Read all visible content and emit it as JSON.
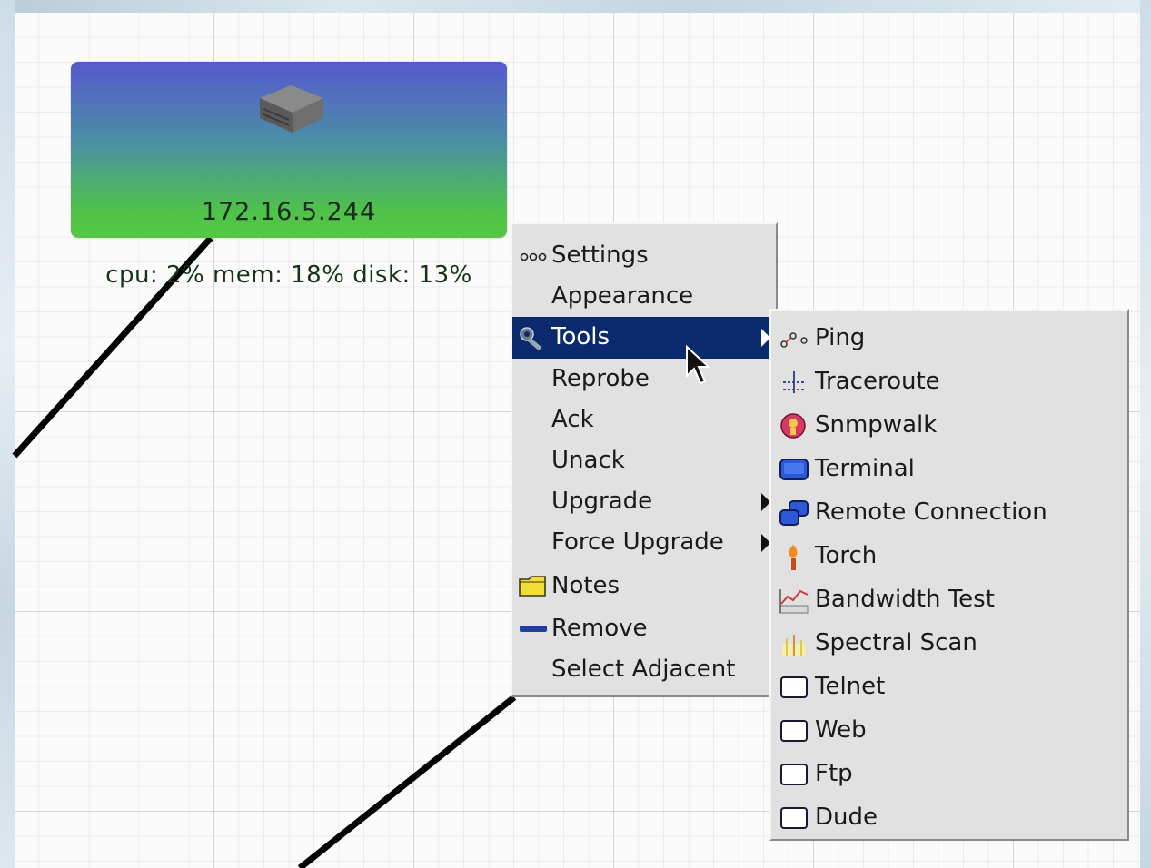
{
  "device": {
    "ip": "172.16.5.244",
    "stats": "cpu: 2% mem: 18% disk: 13%",
    "icon": "server-icon"
  },
  "context_menu": {
    "items": [
      {
        "label": "Settings",
        "icon": "settings-icon"
      },
      {
        "label": "Appearance"
      },
      {
        "label": "Tools",
        "icon": "tools-icon",
        "submenu": true,
        "highlighted": true
      },
      {
        "label": "Reprobe"
      },
      {
        "label": "Ack"
      },
      {
        "label": "Unack"
      },
      {
        "label": "Upgrade",
        "submenu": true
      },
      {
        "label": "Force Upgrade",
        "submenu": true
      },
      {
        "label": "Notes",
        "icon": "notes-folder-icon"
      },
      {
        "label": "Remove",
        "icon": "remove-icon"
      },
      {
        "label": "Select Adjacent"
      }
    ]
  },
  "tools_submenu": {
    "items": [
      {
        "label": "Ping",
        "icon": "ping-icon"
      },
      {
        "label": "Traceroute",
        "icon": "traceroute-icon"
      },
      {
        "label": "Snmpwalk",
        "icon": "snmpwalk-icon"
      },
      {
        "label": "Terminal",
        "icon": "terminal-icon"
      },
      {
        "label": "Remote Connection",
        "icon": "remote-connection-icon"
      },
      {
        "label": "Torch",
        "icon": "torch-icon"
      },
      {
        "label": "Bandwidth Test",
        "icon": "bandwidth-test-icon"
      },
      {
        "label": "Spectral Scan",
        "icon": "spectral-scan-icon"
      },
      {
        "label": "Telnet",
        "icon": "window-icon"
      },
      {
        "label": "Web",
        "icon": "window-icon"
      },
      {
        "label": "Ftp",
        "icon": "window-icon"
      },
      {
        "label": "Dude",
        "icon": "window-icon"
      }
    ]
  },
  "colors": {
    "highlight": "#0b2a6e",
    "menu_bg": "#e1e1e1",
    "device_top": "#5658cf",
    "device_bottom": "#55c842"
  }
}
